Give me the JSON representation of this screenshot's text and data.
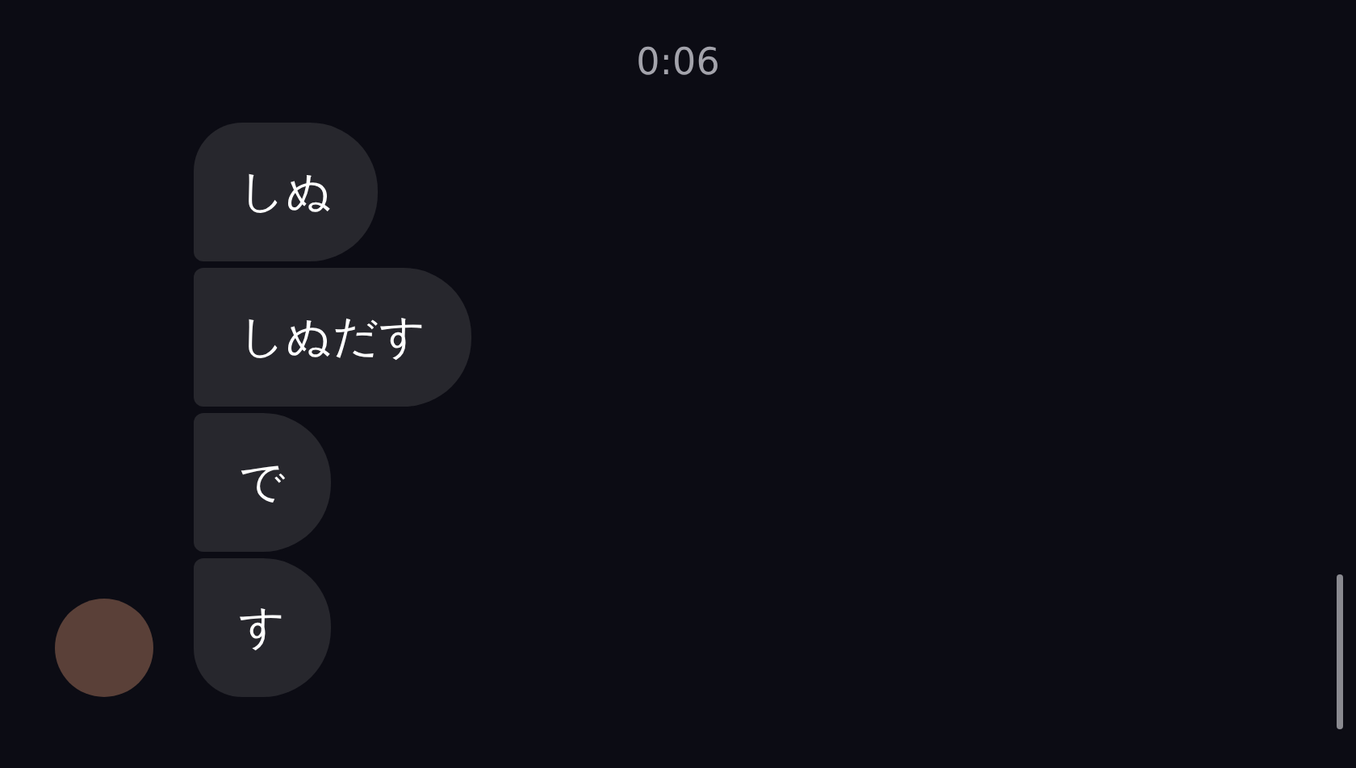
{
  "timestamp": "0:06",
  "messages": [
    {
      "text": "しぬ"
    },
    {
      "text": "しぬだす"
    },
    {
      "text": "で"
    },
    {
      "text": "す"
    }
  ]
}
